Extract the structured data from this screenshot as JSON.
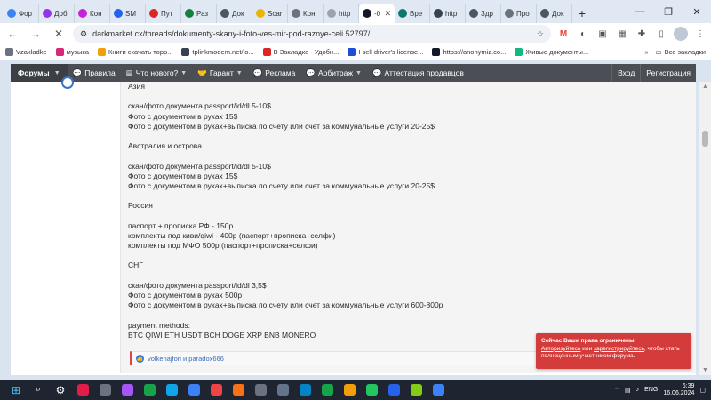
{
  "browser": {
    "tabs": [
      {
        "label": "Фор",
        "color": "#3b82f6"
      },
      {
        "label": "Доб",
        "color": "#9333ea"
      },
      {
        "label": "Кон",
        "color": "#c026d3"
      },
      {
        "label": "SM",
        "color": "#2563eb"
      },
      {
        "label": "Пут",
        "color": "#dc2626"
      },
      {
        "label": "Раз",
        "color": "#15803d"
      },
      {
        "label": "Док",
        "color": "#4b5563"
      },
      {
        "label": "Scar",
        "color": "#eab308"
      },
      {
        "label": "Кон",
        "color": "#6b7280"
      },
      {
        "label": "http",
        "color": "#9ca3af"
      },
      {
        "label": "-0",
        "color": "#111827",
        "active": true
      },
      {
        "label": "Вре",
        "color": "#0f766e"
      },
      {
        "label": "http",
        "color": "#374151"
      },
      {
        "label": "Здр",
        "color": "#4b5563"
      },
      {
        "label": "Про",
        "color": "#6b7280"
      },
      {
        "label": "Док",
        "color": "#4b5563"
      }
    ],
    "new_tab": "+",
    "url": "darkmarket.cx/threads/dokumenty-skany-i-foto-ves-mir-pod-raznye-celi.52797/",
    "bookmarks": [
      {
        "label": "Vzakladke",
        "color": "#6b7280"
      },
      {
        "label": "музыка",
        "color": "#db2777"
      },
      {
        "label": "Книги скачать торр...",
        "color": "#f59e0b"
      },
      {
        "label": "tplinkmodem.net/lo...",
        "color": "#374151"
      },
      {
        "label": "В Закладке - Удобн...",
        "color": "#dc2626"
      },
      {
        "label": "I sell driver's license...",
        "color": "#1d4ed8"
      },
      {
        "label": "https://anonymiz.co...",
        "color": "#111827"
      },
      {
        "label": "Живые документы...",
        "color": "#10b981"
      }
    ],
    "all_bookmarks": "Все закладки",
    "more_bookmarks": "»"
  },
  "site_nav": {
    "forums": "Форумы",
    "items": [
      {
        "label": "Правила",
        "icon": "💬",
        "dropdown": false
      },
      {
        "label": "Что нового?",
        "icon": "▤",
        "dropdown": true
      },
      {
        "label": "Гарант",
        "icon": "🤝",
        "dropdown": true
      },
      {
        "label": "Реклама",
        "icon": "💬",
        "dropdown": false
      },
      {
        "label": "Арбитраж",
        "icon": "💬",
        "dropdown": true
      },
      {
        "label": "Аттестация продавцов",
        "icon": "💬",
        "dropdown": false
      }
    ],
    "login": "Вход",
    "register": "Регистрация"
  },
  "post": {
    "lines": [
      "Азия",
      "",
      "скан/фото документа passport/id/dl 5-10$",
      "Фото с документом в руках 15$",
      "Фото с документом в руках+выписка по счету или счет за коммунальные услуги 20-25$",
      "",
      "Австралия и острова",
      "",
      "скан/фото документа passport/id/dl 5-10$",
      "Фото с документом в руках 15$",
      "Фото с документом в руках+выписка по счету или счет за коммунальные услуги 20-25$",
      "",
      "Россия",
      "",
      "паспорт + прописка РФ - 150р",
      "комплекты под киви/qiwi - 400р (паспорт+прописка+селфи)",
      "комплекты под МФО 500р (паспорт+прописка+селфи)",
      "",
      "СНГ",
      "",
      "скан/фото документа passport/id/dl 3,5$",
      "Фото с документом в руках 500р",
      "Фото с документом в руках+выписка по счету или счет за коммунальные услуги 600-800р",
      "",
      "payment methods:",
      "BTC QIWI ETH USDT BCH DOGE XRP BNB MONERO"
    ],
    "reactions": "volkenajfori и paradox666"
  },
  "toast": {
    "title": "Сейчас Ваши права ограничены!",
    "link1": "Авторизуйтесь",
    "middle": " или ",
    "link2": "зарегистрируйтесь",
    "rest": ", чтобы стать полноценным участником форума."
  },
  "taskbar": {
    "apps": [
      "#e11d48",
      "#6b7280",
      "#a855f7",
      "#16a34a",
      "#0ea5e9",
      "#3b82f6",
      "#ef4444",
      "#f97316",
      "#6b7280",
      "#64748b",
      "#0284c7",
      "#16a34a",
      "#f59e0b",
      "#22c55e",
      "#2563eb",
      "#84cc16",
      "#3b82f6"
    ],
    "lang": "ENG",
    "time": "6:39",
    "date": "16.06.2024"
  }
}
